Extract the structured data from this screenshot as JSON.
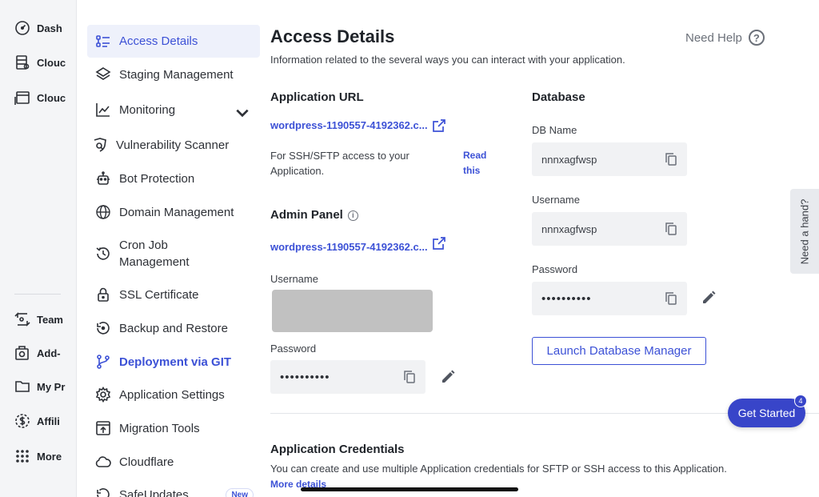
{
  "rail": {
    "items": [
      {
        "label": "Dash",
        "icon": "gauge-icon"
      },
      {
        "label": "Clouc",
        "icon": "server-icon"
      },
      {
        "label": "Clouc",
        "icon": "window-icon"
      },
      {
        "label": "Team",
        "icon": "team-icon"
      },
      {
        "label": "Add-",
        "icon": "addon-icon"
      },
      {
        "label": "My Pr",
        "icon": "folder-icon"
      },
      {
        "label": "Affili",
        "icon": "dollar-icon"
      },
      {
        "label": "More",
        "icon": "grid-icon"
      }
    ]
  },
  "subnav": {
    "items": [
      {
        "label": "Access Details",
        "icon": "list-icon",
        "state": "active"
      },
      {
        "label": "Staging Management",
        "icon": "layers-icon"
      },
      {
        "label": "Monitoring",
        "icon": "chart-icon",
        "expandable": true
      },
      {
        "label": "Vulnerability Scanner",
        "icon": "shield-scan-icon"
      },
      {
        "label": "Bot Protection",
        "icon": "robot-icon"
      },
      {
        "label": "Domain Management",
        "icon": "globe-www-icon"
      },
      {
        "label": "Cron Job Management",
        "icon": "history-icon"
      },
      {
        "label": "SSL Certificate",
        "icon": "lock-icon"
      },
      {
        "label": "Backup and Restore",
        "icon": "restore-icon"
      },
      {
        "label": "Deployment via GIT",
        "icon": "git-branch-icon",
        "state": "link"
      },
      {
        "label": "Application Settings",
        "icon": "gear-icon"
      },
      {
        "label": "Migration Tools",
        "icon": "migration-icon"
      },
      {
        "label": "Cloudflare",
        "icon": "cloud-icon"
      },
      {
        "label": "SafeUpdates",
        "icon": "safeupdates-icon",
        "badge": "New"
      }
    ]
  },
  "main": {
    "title": "Access Details",
    "subtitle": "Information related to the several ways you can interact with your application.",
    "need_help": "Need Help",
    "app_url": {
      "heading": "Application URL",
      "url": "wordpress-1190557-4192362.c...",
      "ssh_note": "For SSH/SFTP access to your Application.",
      "read_this": "Read this"
    },
    "admin_panel": {
      "heading": "Admin Panel",
      "url": "wordpress-1190557-4192362.c...",
      "username_label": "Username",
      "password_label": "Password",
      "password_value": "••••••••••"
    },
    "database": {
      "heading": "Database",
      "db_name_label": "DB Name",
      "db_name_value": "nnnxagfwsp",
      "username_label": "Username",
      "username_value": "nnnxagfwsp",
      "password_label": "Password",
      "password_value": "••••••••••",
      "launch_button": "Launch Database Manager"
    },
    "credentials": {
      "heading": "Application Credentials",
      "description": "You can create and use multiple Application credentials for SFTP or SSH access to this Application.",
      "more_details": "More details"
    }
  },
  "side_tab": "Need a hand?",
  "get_started": {
    "label": "Get Started",
    "count": "4"
  },
  "colors": {
    "accent": "#3c51d6",
    "button": "#3845c9",
    "field_bg": "#f1f2f4",
    "active_bg": "#eef1fb"
  }
}
